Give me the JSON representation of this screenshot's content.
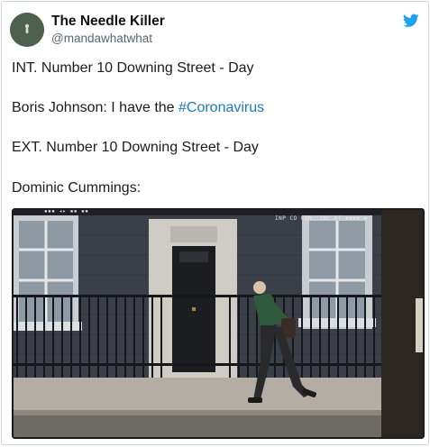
{
  "author": {
    "display_name": "The Needle Killer",
    "handle": "@mandawhatwhat",
    "avatar_icon": "avatar-figure-icon"
  },
  "platform_icon": "twitter-bird-icon",
  "brand_color": "#1da1f2",
  "tweet": {
    "line1": "INT. Number 10 Downing Street - Day",
    "line2_prefix": "Boris Johnson: I have the ",
    "line2_hashtag": "#Coronavirus",
    "line3": "EXT. Number 10 Downing Street - Day",
    "line4": "Dominic Cummings:"
  },
  "video": {
    "overlay_left": "▪▪▪ ◂▸ ▪▪ ▪▪",
    "overlay_right": "INP CO CUN. INL AT ▪▪▪▪ ▪"
  }
}
